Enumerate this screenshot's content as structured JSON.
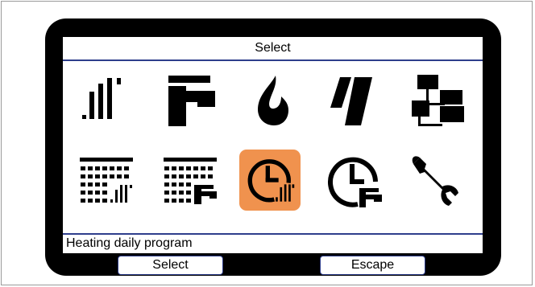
{
  "header": {
    "title": "Select"
  },
  "icons": [
    {
      "name": "signal-levels-icon",
      "selected": false
    },
    {
      "name": "tap-icon",
      "selected": false
    },
    {
      "name": "flame-icon",
      "selected": false
    },
    {
      "name": "solar-panel-icon",
      "selected": false
    },
    {
      "name": "network-icon",
      "selected": false
    },
    {
      "name": "calendar-heating-icon",
      "selected": false
    },
    {
      "name": "calendar-hot-water-icon",
      "selected": false
    },
    {
      "name": "clock-heating-icon",
      "selected": true
    },
    {
      "name": "clock-hot-water-icon",
      "selected": false
    },
    {
      "name": "wrench-icon",
      "selected": false
    }
  ],
  "colors": {
    "accent": "#f0924e",
    "line": "#2e3e8c",
    "bezel": "#000000"
  },
  "status": {
    "text": "Heating daily program"
  },
  "softkeys": {
    "left": "Select",
    "right": "Escape"
  }
}
